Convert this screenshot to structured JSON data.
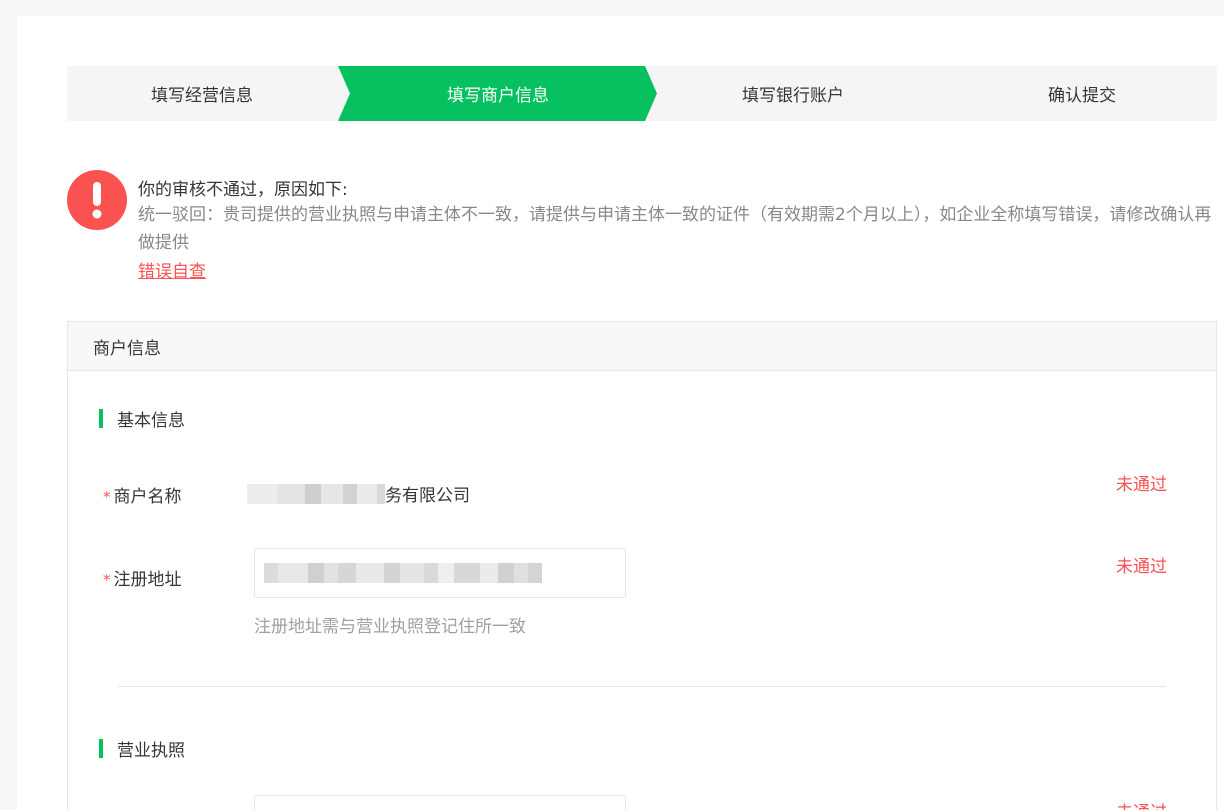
{
  "steps": [
    {
      "label": "填写经营信息",
      "active": false
    },
    {
      "label": "填写商户信息",
      "active": true
    },
    {
      "label": "填写银行账户",
      "active": false
    },
    {
      "label": "确认提交",
      "active": false
    }
  ],
  "alert": {
    "icon": "exclamation-icon",
    "title": "你的审核不通过，原因如下:",
    "description": "统一驳回：贵司提供的营业执照与申请主体不一致，请提供与申请主体一致的证件（有效期需2个月以上），如企业全称填写错误，请修改确认再做提供",
    "link": "错误自查"
  },
  "card": {
    "title": "商户信息",
    "sections": {
      "basic": {
        "title": "基本信息",
        "merchant_name": {
          "label": "商户名称",
          "required_mark": "*",
          "value_visible": "务有限公司",
          "status": "未通过"
        },
        "address": {
          "label": "注册地址",
          "required_mark": "*",
          "hint": "注册地址需与营业执照登记住所一致",
          "status": "未通过"
        }
      },
      "license": {
        "title": "营业执照",
        "status": "未通过"
      }
    }
  },
  "colors": {
    "accent": "#07c160",
    "error": "#fa5151",
    "text": "#353535",
    "muted": "#888888"
  }
}
